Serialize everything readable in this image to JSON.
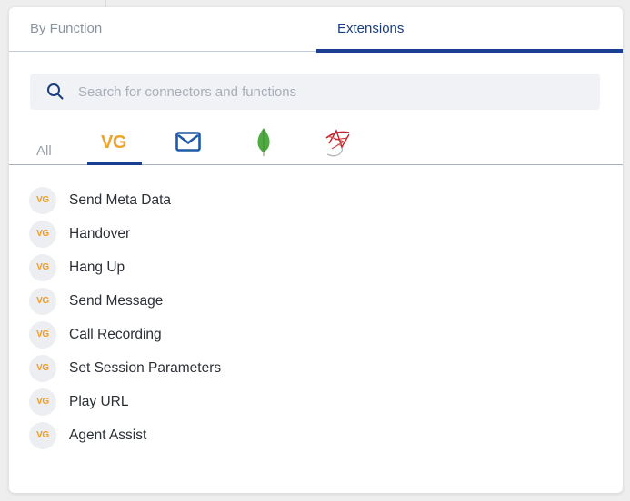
{
  "top_tabs": [
    {
      "label": "By Function",
      "active": false
    },
    {
      "label": "Extensions",
      "active": true
    }
  ],
  "search": {
    "placeholder": "Search for connectors and functions",
    "value": ""
  },
  "filter_tabs": {
    "all_label": "All",
    "vg_label": "VG",
    "active": "vg",
    "icons": [
      "mail-icon",
      "mongodb-icon",
      "sql-server-icon"
    ]
  },
  "badge_label": "VG",
  "items": [
    {
      "label": "Send Meta Data"
    },
    {
      "label": "Handover"
    },
    {
      "label": "Hang Up"
    },
    {
      "label": "Send Message"
    },
    {
      "label": "Call Recording"
    },
    {
      "label": "Set Session Parameters"
    },
    {
      "label": "Play URL"
    },
    {
      "label": "Agent Assist"
    }
  ],
  "colors": {
    "accent": "#183f92",
    "vg_orange": "#f0a22b",
    "mongo_green": "#4faa41",
    "sql_red": "#c8242b"
  }
}
